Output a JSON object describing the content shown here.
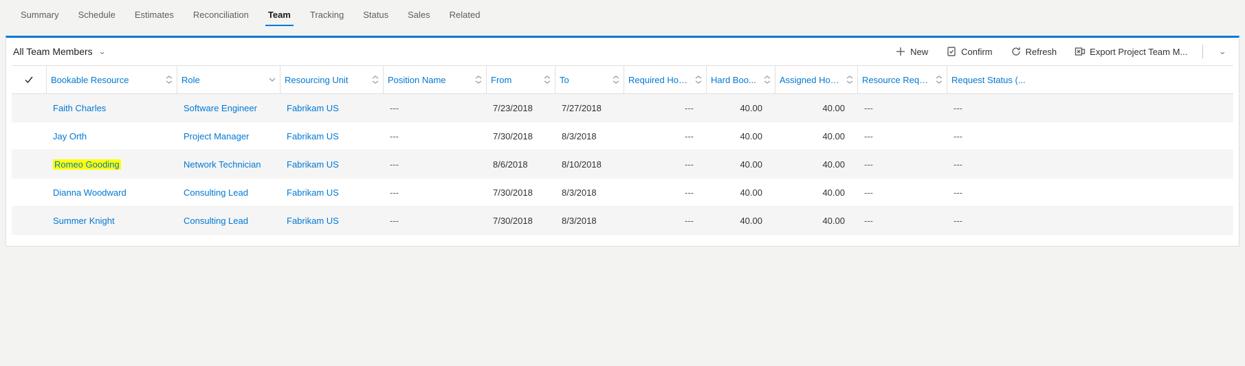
{
  "nav": {
    "tabs": [
      {
        "label": "Summary"
      },
      {
        "label": "Schedule"
      },
      {
        "label": "Estimates"
      },
      {
        "label": "Reconciliation"
      },
      {
        "label": "Team",
        "active": true
      },
      {
        "label": "Tracking"
      },
      {
        "label": "Status"
      },
      {
        "label": "Sales"
      },
      {
        "label": "Related"
      }
    ]
  },
  "view": {
    "title": "All Team Members"
  },
  "toolbar": {
    "new": "New",
    "confirm": "Confirm",
    "refresh": "Refresh",
    "export": "Export Project Team M..."
  },
  "columns": [
    {
      "label": "Bookable Resource",
      "sort": "both"
    },
    {
      "label": "Role",
      "sort": "down"
    },
    {
      "label": "Resourcing Unit",
      "sort": "both"
    },
    {
      "label": "Position Name",
      "sort": "both"
    },
    {
      "label": "From",
      "sort": "both"
    },
    {
      "label": "To",
      "sort": "both"
    },
    {
      "label": "Required Hours",
      "sort": "both"
    },
    {
      "label": "Hard Boo...",
      "sort": "both"
    },
    {
      "label": "Assigned Hours",
      "sort": "both"
    },
    {
      "label": "Resource Require...",
      "sort": "both"
    },
    {
      "label": "Request Status (...",
      "sort": ""
    }
  ],
  "rows": [
    {
      "resource": "Faith Charles",
      "role": "Software Engineer",
      "unit": "Fabrikam US",
      "position": "---",
      "from": "7/23/2018",
      "to": "7/27/2018",
      "required": "---",
      "hard": "40.00",
      "assigned": "40.00",
      "resreq": "---",
      "reqstatus": "---",
      "highlight": false
    },
    {
      "resource": "Jay Orth",
      "role": "Project Manager",
      "unit": "Fabrikam US",
      "position": "---",
      "from": "7/30/2018",
      "to": "8/3/2018",
      "required": "---",
      "hard": "40.00",
      "assigned": "40.00",
      "resreq": "---",
      "reqstatus": "---",
      "highlight": false
    },
    {
      "resource": "Romeo Gooding",
      "role": "Network Technician",
      "unit": "Fabrikam US",
      "position": "---",
      "from": "8/6/2018",
      "to": "8/10/2018",
      "required": "---",
      "hard": "40.00",
      "assigned": "40.00",
      "resreq": "---",
      "reqstatus": "---",
      "highlight": true
    },
    {
      "resource": "Dianna Woodward",
      "role": "Consulting Lead",
      "unit": "Fabrikam US",
      "position": "---",
      "from": "7/30/2018",
      "to": "8/3/2018",
      "required": "---",
      "hard": "40.00",
      "assigned": "40.00",
      "resreq": "---",
      "reqstatus": "---",
      "highlight": false
    },
    {
      "resource": "Summer Knight",
      "role": "Consulting Lead",
      "unit": "Fabrikam US",
      "position": "---",
      "from": "7/30/2018",
      "to": "8/3/2018",
      "required": "---",
      "hard": "40.00",
      "assigned": "40.00",
      "resreq": "---",
      "reqstatus": "---",
      "highlight": false
    }
  ]
}
